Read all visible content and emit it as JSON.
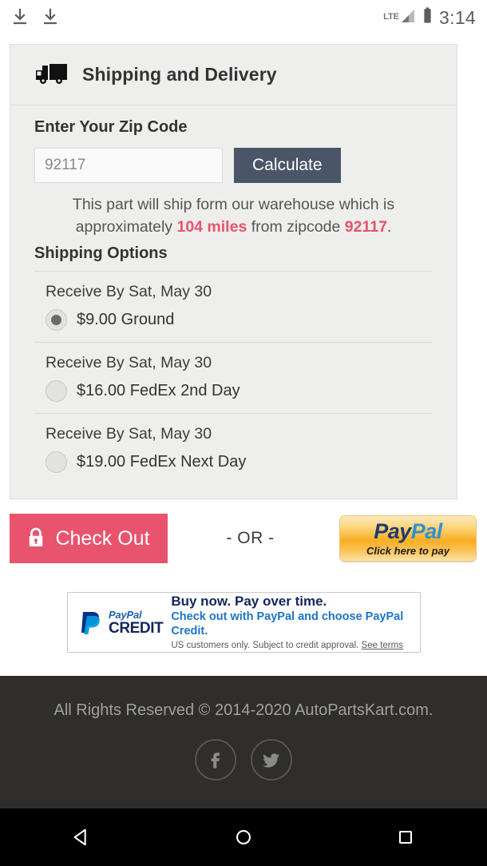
{
  "statusbar": {
    "download_icon_1": "download-icon",
    "download_icon_2": "download-icon",
    "network_label": "LTE",
    "signal_icon": "signal-bars-icon",
    "battery_icon": "battery-full-icon",
    "time": "3:14"
  },
  "card": {
    "truck_icon": "delivery-truck-icon",
    "title": "Shipping and Delivery",
    "zip_section_label": "Enter Your Zip Code",
    "zip_input_value": "92117",
    "zip_input_placeholder": "92117",
    "calculate_label": "Calculate",
    "ship_note": {
      "part1": "This part will ship form our warehouse which is approximately ",
      "distance": "104 miles",
      "part2": " from zipcode ",
      "zipcode": "92117",
      "part3": "."
    },
    "options_label": "Shipping Options",
    "options": [
      {
        "eta": "Receive By Sat, May 30",
        "price_label": "$9.00 Ground",
        "selected": true
      },
      {
        "eta": "Receive By Sat, May 30",
        "price_label": "$16.00 FedEx 2nd Day",
        "selected": false
      },
      {
        "eta": "Receive By Sat, May 30",
        "price_label": "$19.00 FedEx Next Day",
        "selected": false
      }
    ]
  },
  "checkout": {
    "lock_icon": "lock-icon",
    "checkout_label": "Check Out",
    "or_label": "- OR -",
    "paypal": {
      "logo_pay": "Pay",
      "logo_pal": "Pal",
      "subtitle": "Click here to pay"
    }
  },
  "paypal_credit": {
    "logo_mark": "paypal-p-icon",
    "logo_paypal": "PayPal",
    "logo_credit": "CREDIT",
    "headline": "Buy now. Pay over time.",
    "subline": "Check out with PayPal and choose PayPal Credit.",
    "fine_print": "US customers only. Subject to credit approval. ",
    "terms_link": "See terms"
  },
  "footer": {
    "copyright": "All Rights Reserved © 2014-2020 AutoPartsKart.com.",
    "facebook_icon": "facebook-icon",
    "twitter_icon": "twitter-icon"
  },
  "navbar": {
    "back_icon": "back-triangle-icon",
    "home_icon": "home-circle-icon",
    "recents_icon": "recents-square-icon"
  },
  "colors": {
    "accent_pink": "#e8536d",
    "calculate_slate": "#4a5568",
    "card_bg": "#eeeeec",
    "footer_bg": "#2f2e2c"
  }
}
